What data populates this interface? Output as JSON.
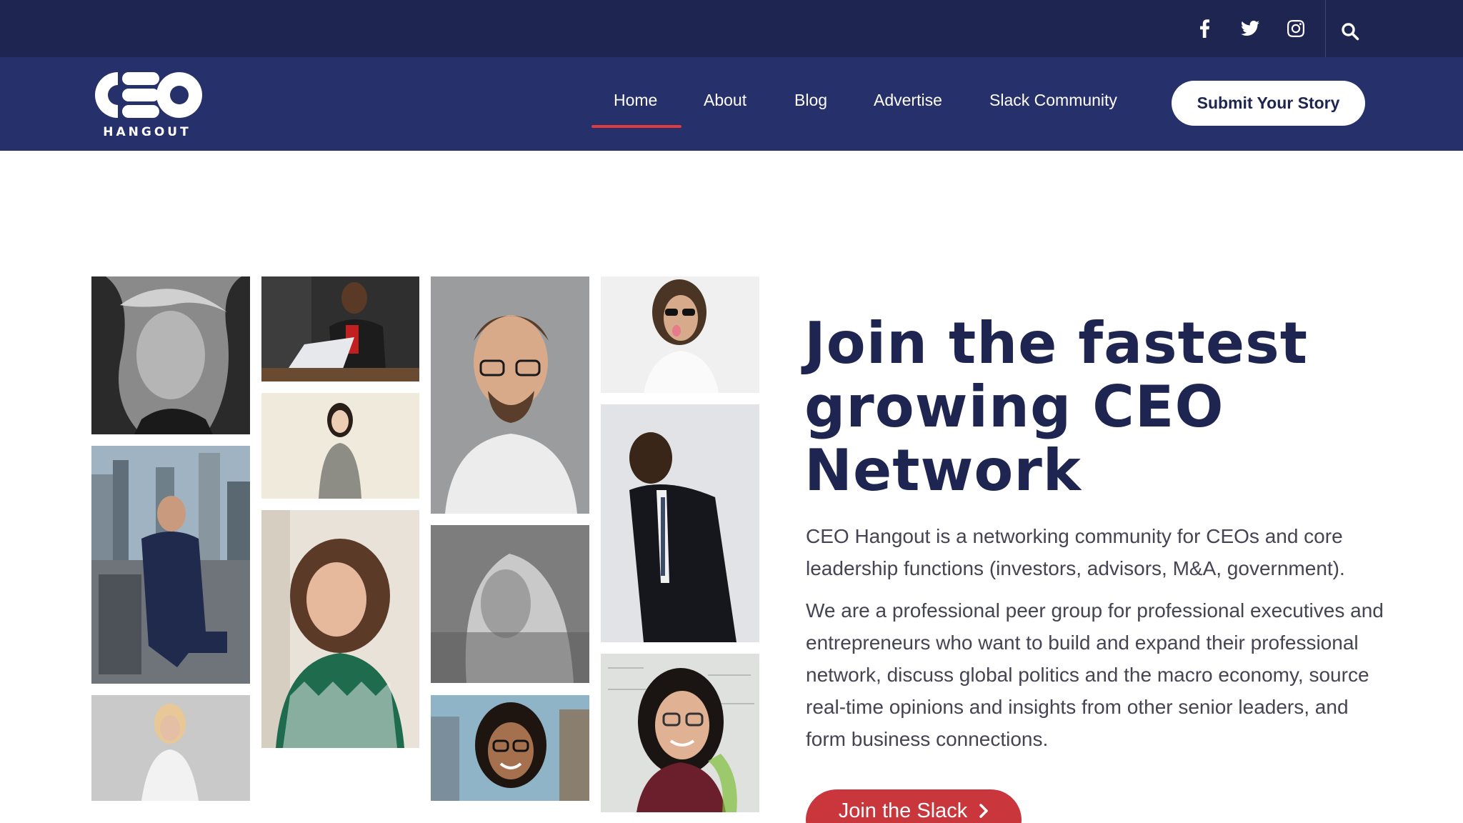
{
  "topbar": {
    "social": [
      {
        "name": "facebook-icon"
      },
      {
        "name": "twitter-icon"
      },
      {
        "name": "instagram-icon"
      }
    ],
    "search_icon": "search-icon"
  },
  "logo": {
    "word": "CEO",
    "sub": "HANGOUT"
  },
  "nav": {
    "items": [
      {
        "label": "Home",
        "active": true
      },
      {
        "label": "About"
      },
      {
        "label": "Blog"
      },
      {
        "label": "Advertise"
      },
      {
        "label": "Slack Community"
      }
    ],
    "cta": "Submit Your Story"
  },
  "hero": {
    "title": "Join the fastest growing CEO Network",
    "paragraph1": "CEO Hangout is a networking community for CEOs and core leadership functions (investors, advisors, M&A, government).",
    "paragraph2": "We are a professional peer group for professional executives and entrepreneurs who want to build and expand their professional network, discuss global politics and the macro economy, source real-time opinions and insights from other senior leaders, and form business connections.",
    "cta": "Join the Slack"
  },
  "colors": {
    "topbar": "#1e2550",
    "nav": "#26306a",
    "accent": "#c9373d",
    "title": "#1e2550"
  }
}
